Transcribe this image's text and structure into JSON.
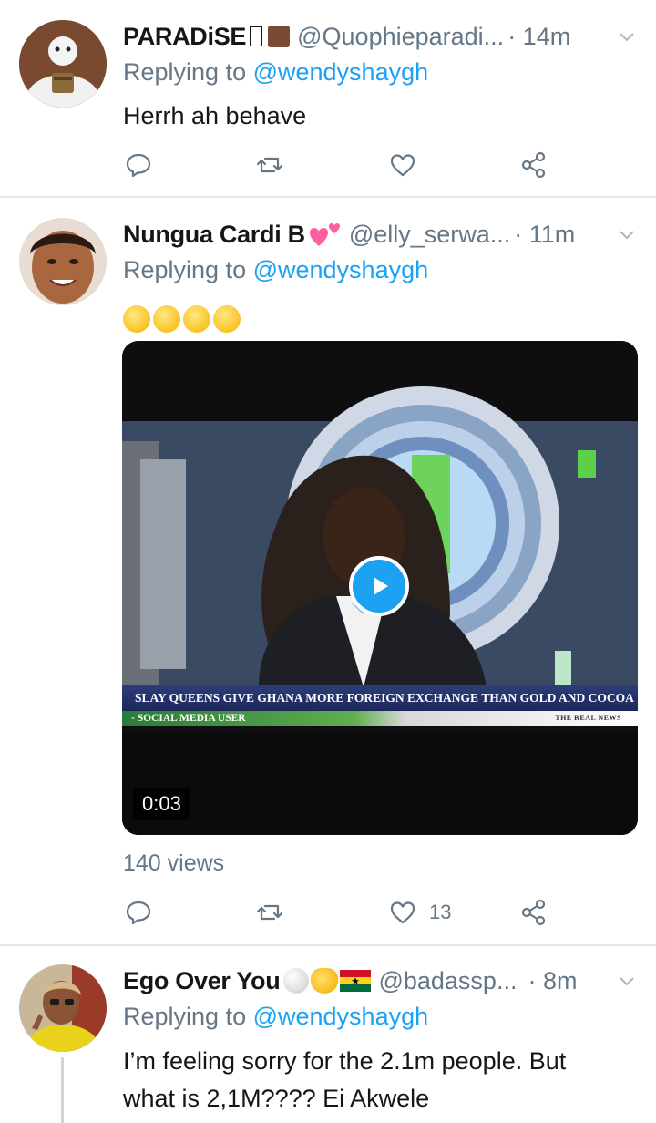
{
  "tweets": [
    {
      "name": "PARADiSE ",
      "name_emoji": [
        "missing-glyph",
        "brown-square"
      ],
      "handle": "@Quophieparadi...",
      "time": "· 14m",
      "replying_prefix": "Replying to ",
      "replying_to": "@wendyshaygh",
      "text": "Herrh ah behave",
      "actions": {
        "reply_count": "",
        "retweet_count": "",
        "like_count": ""
      }
    },
    {
      "name": "Nungua Cardi B",
      "name_emoji": [
        "two-hearts"
      ],
      "handle": "@elly_serwa...",
      "time": "· 11m",
      "replying_prefix": "Replying to ",
      "replying_to": "@wendyshaygh",
      "text_emoji": [
        "face-with-tears-of-joy",
        "face-with-tears-of-joy",
        "face-with-tears-of-joy",
        "face-with-tears-of-joy"
      ],
      "video": {
        "duration": "0:03",
        "ticker": "SLAY QUEENS GIVE GHANA MORE FOREIGN EXCHANGE THAN GOLD AND COCOA",
        "subticker": "- SOCIAL MEDIA USER",
        "watermark": "THE REAL NEWS"
      },
      "views": "140 views",
      "actions": {
        "reply_count": "",
        "retweet_count": "",
        "like_count": "13"
      }
    },
    {
      "name": "Ego Over You",
      "name_emoji": [
        "white-circle",
        "crying-laughing-cat",
        "ghana-flag"
      ],
      "handle": "@badassp...",
      "time": "· 8m",
      "replying_prefix": "Replying to ",
      "replying_to": "@wendyshaygh",
      "text_line1": "I’m feeling sorry for the 2.1m people. But",
      "text_line2": "what is 2,1M???? Ei Akwele",
      "actions": {
        "reply_count": "",
        "retweet_count": "",
        "like_count": ""
      }
    }
  ],
  "colors": {
    "accent": "#1da1f2",
    "secondary_text": "#657786",
    "primary_text": "#14171a",
    "divider": "#e1e8ed"
  },
  "icons": [
    "reply-icon",
    "retweet-icon",
    "like-icon",
    "share-icon",
    "caret-down-icon",
    "play-icon"
  ]
}
